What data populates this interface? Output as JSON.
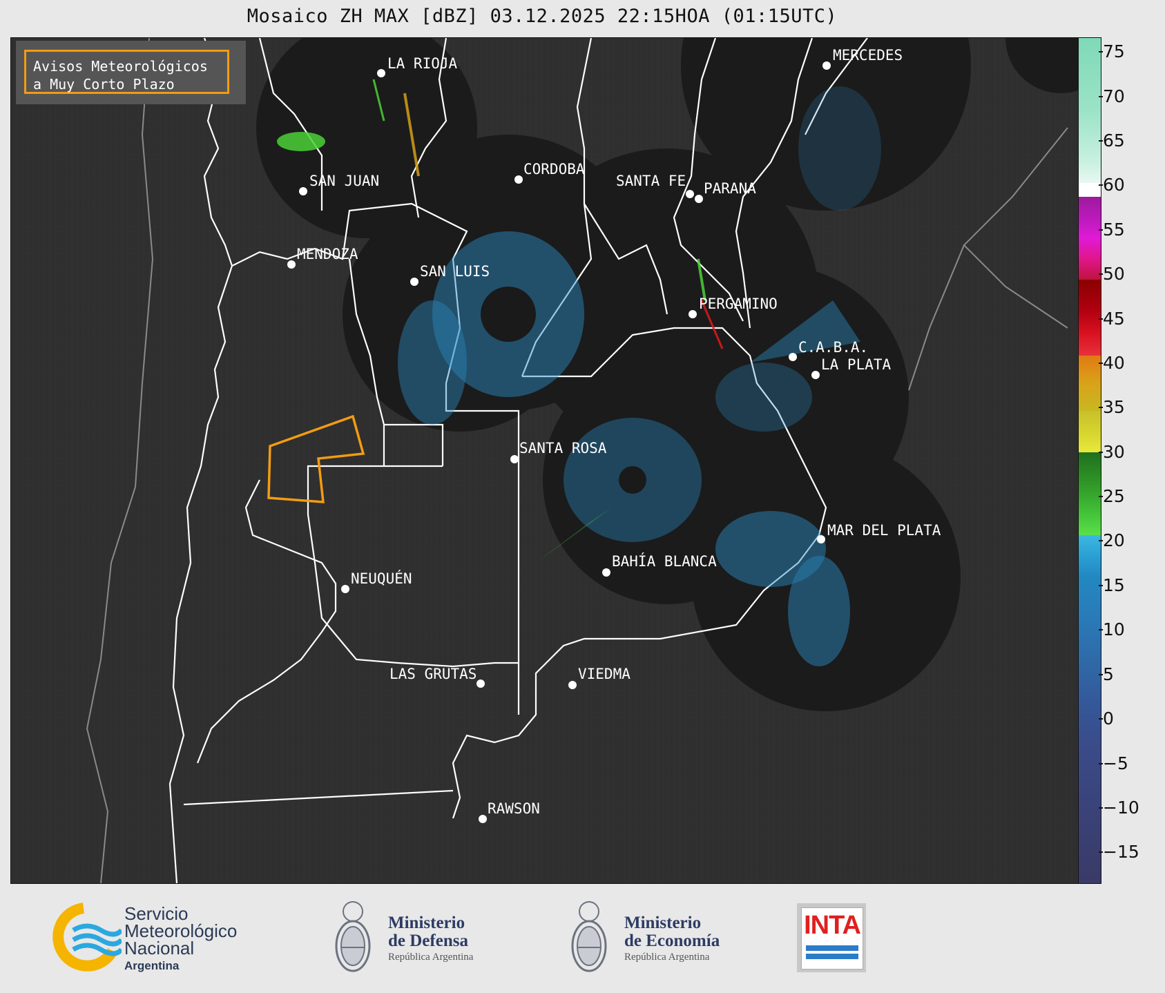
{
  "title": "Mosaico ZH MAX [dBZ] 03.12.2025 22:15HOA (01:15UTC)",
  "legend_box": {
    "line1": "Avisos Meteorológicos",
    "line2": "a Muy Corto Plazo"
  },
  "colors": {
    "background": "#2f2f2f",
    "radar_coverage": "#1b1b1b",
    "warning_outline": "#f39c12",
    "province_borders": "#ffffff"
  },
  "cities": [
    {
      "name": "LA RIOJA"
    },
    {
      "name": "MERCEDES"
    },
    {
      "name": "SAN JUAN"
    },
    {
      "name": "CORDOBA"
    },
    {
      "name": "SANTA FE"
    },
    {
      "name": "PARANA"
    },
    {
      "name": "MENDOZA"
    },
    {
      "name": "SAN LUIS"
    },
    {
      "name": "PERGAMINO"
    },
    {
      "name": "C.A.B.A."
    },
    {
      "name": "LA PLATA"
    },
    {
      "name": "SANTA ROSA"
    },
    {
      "name": "MAR DEL PLATA"
    },
    {
      "name": "BAHÍA BLANCA"
    },
    {
      "name": "NEUQUÉN"
    },
    {
      "name": "LAS GRUTAS"
    },
    {
      "name": "VIEDMA"
    },
    {
      "name": "RAWSON"
    }
  ],
  "colorbar": {
    "unit": "dBZ",
    "ticks": [
      "75",
      "70",
      "65",
      "60",
      "55",
      "50",
      "45",
      "40",
      "35",
      "30",
      "25",
      "20",
      "15",
      "10",
      "5",
      "0",
      "−5",
      "−10",
      "−15"
    ]
  },
  "footer": {
    "smn": {
      "line1": "Servicio",
      "line2": "Meteorológico",
      "line3": "Nacional",
      "line4": "Argentina"
    },
    "defensa": {
      "line1": "Ministerio",
      "line2": "de Defensa",
      "line3": "República Argentina"
    },
    "economia": {
      "line1": "Ministerio",
      "line2": "de Economía",
      "line3": "República Argentina"
    },
    "inta": {
      "text": "INTA"
    }
  }
}
